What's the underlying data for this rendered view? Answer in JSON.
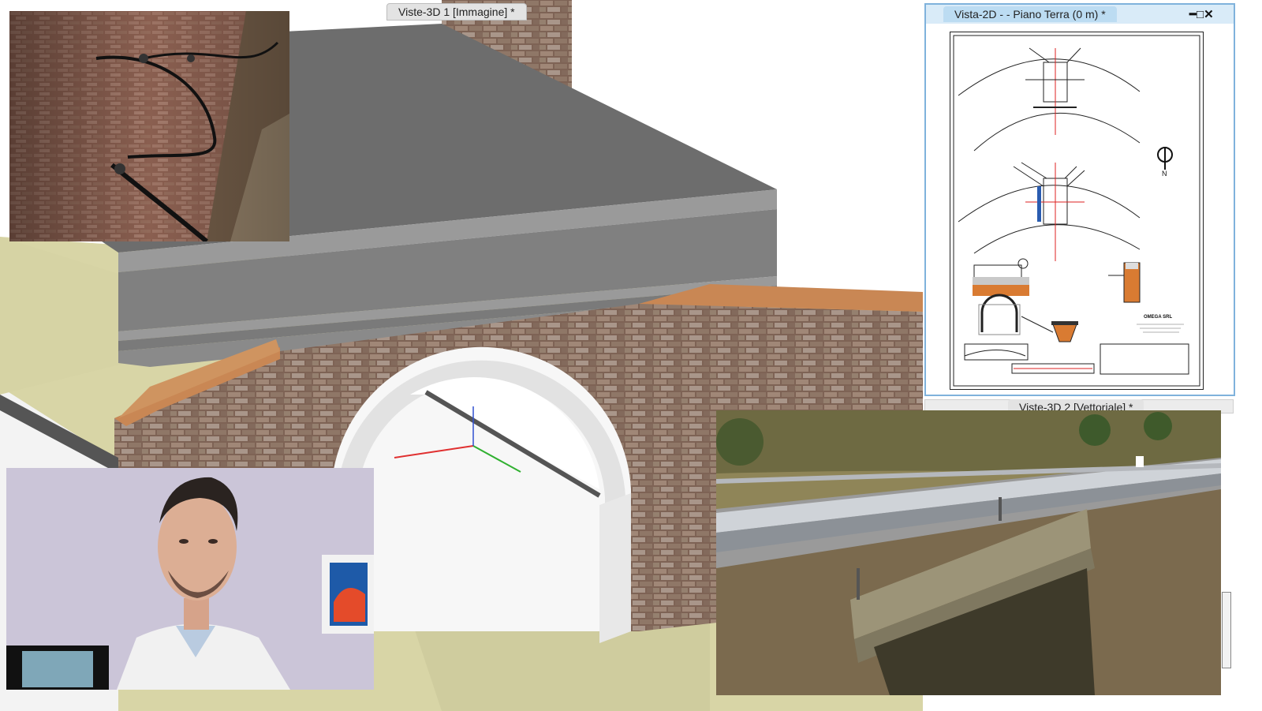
{
  "views": {
    "view3d_1": {
      "title": "Viste-3D 1 [Immagine] *"
    },
    "view2d": {
      "title": "Vista-2D -  - Piano Terra (0 m) *"
    },
    "view3d_2": {
      "title": "Viste-3D 2 [Vettoriale] *"
    }
  },
  "drawing": {
    "company": "OMEGA SRL",
    "north": "N"
  },
  "colors": {
    "tab_active": "#cfe6f6",
    "window_border": "#7fb2dc",
    "tab_inactive": "#e3e3e3",
    "roof": "#6d6d6d",
    "cornice": "#8a8a8a",
    "ground": "#d9d6a8",
    "brick": "#8b6f5f",
    "terracotta": "#c98754"
  },
  "icons": {
    "minimize": "minimize-icon",
    "maximize": "maximize-icon",
    "close": "close-icon"
  }
}
